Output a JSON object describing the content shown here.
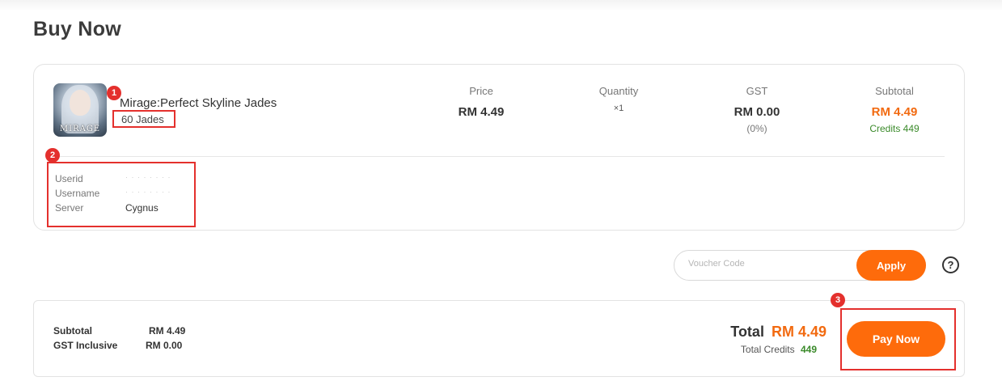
{
  "page": {
    "title": "Buy Now"
  },
  "product": {
    "name": "Mirage:Perfect Skyline Jades",
    "variant": "60 Jades",
    "thumb_logo": "MIRAGE"
  },
  "columns": {
    "price": {
      "header": "Price",
      "value": "RM 4.49"
    },
    "quantity": {
      "header": "Quantity",
      "value": "×1"
    },
    "gst": {
      "header": "GST",
      "value": "RM 0.00",
      "rate": "(0%)"
    },
    "subtotal": {
      "header": "Subtotal",
      "value": "RM 4.49",
      "credits": "Credits 449"
    }
  },
  "account": {
    "userid_label": "Userid",
    "userid_value": "· · · · · · · ·",
    "username_label": "Username",
    "username_value": "· · · · · · · ·",
    "server_label": "Server",
    "server_value": "Cygnus"
  },
  "voucher": {
    "placeholder": "Voucher Code",
    "apply_label": "Apply",
    "help_symbol": "?"
  },
  "summary": {
    "subtotal_label": "Subtotal",
    "subtotal_value": "RM 4.49",
    "gst_label": "GST Inclusive",
    "gst_value": "RM 0.00",
    "total_label": "Total",
    "total_value": "RM 4.49",
    "total_credits_label": "Total Credits",
    "total_credits_value": "449",
    "pay_label": "Pay Now"
  },
  "annotations": {
    "badge1": "1",
    "badge2": "2",
    "badge3": "3"
  },
  "colors": {
    "accent": "#fe6b0b",
    "price_orange": "#f26a10",
    "credits_green": "#3a8a2a",
    "annotation_red": "#e4302d"
  }
}
